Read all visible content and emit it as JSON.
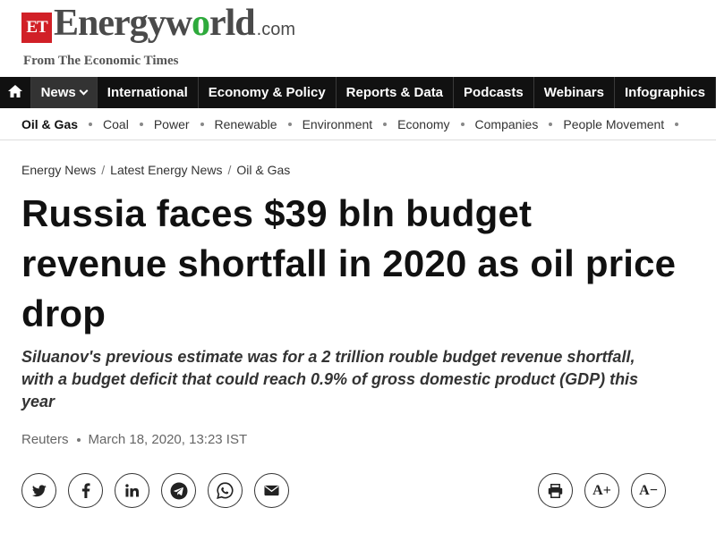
{
  "logo": {
    "et": "ET",
    "brand_part1": "Energyw",
    "brand_o": "o",
    "brand_part2": "rld",
    "brand_domain": ".com",
    "tagline": "From The Economic Times",
    "accent_color": "#d12027",
    "leaf_color": "#2eaa3c"
  },
  "nav": {
    "home_icon": "home-icon",
    "items": [
      {
        "label": "News"
      },
      {
        "label": "International"
      },
      {
        "label": "Economy & Policy"
      },
      {
        "label": "Reports & Data"
      },
      {
        "label": "Podcasts"
      },
      {
        "label": "Webinars"
      },
      {
        "label": "Infographics"
      }
    ]
  },
  "subnav": {
    "items": [
      {
        "label": "Oil & Gas"
      },
      {
        "label": "Coal"
      },
      {
        "label": "Power"
      },
      {
        "label": "Renewable"
      },
      {
        "label": "Environment"
      },
      {
        "label": "Economy"
      },
      {
        "label": "Companies"
      },
      {
        "label": "People Movement"
      }
    ]
  },
  "breadcrumb": [
    "Energy News",
    "Latest Energy News",
    "Oil & Gas"
  ],
  "article": {
    "headline": "Russia faces $39 bln budget revenue shortfall in 2020 as oil price drop",
    "summary": "Siluanov's previous estimate was for a 2 trillion rouble budget revenue shortfall, with a budget deficit that could reach 0.9% of gross domestic product (GDP) this year",
    "source": "Reuters",
    "date": "March 18, 2020, 13:23 IST"
  },
  "share_icons": [
    "twitter-icon",
    "facebook-icon",
    "linkedin-icon",
    "telegram-icon",
    "whatsapp-icon",
    "email-icon"
  ],
  "tools": {
    "print_icon": "print-icon",
    "font_increase": "A+",
    "font_decrease": "A−"
  }
}
